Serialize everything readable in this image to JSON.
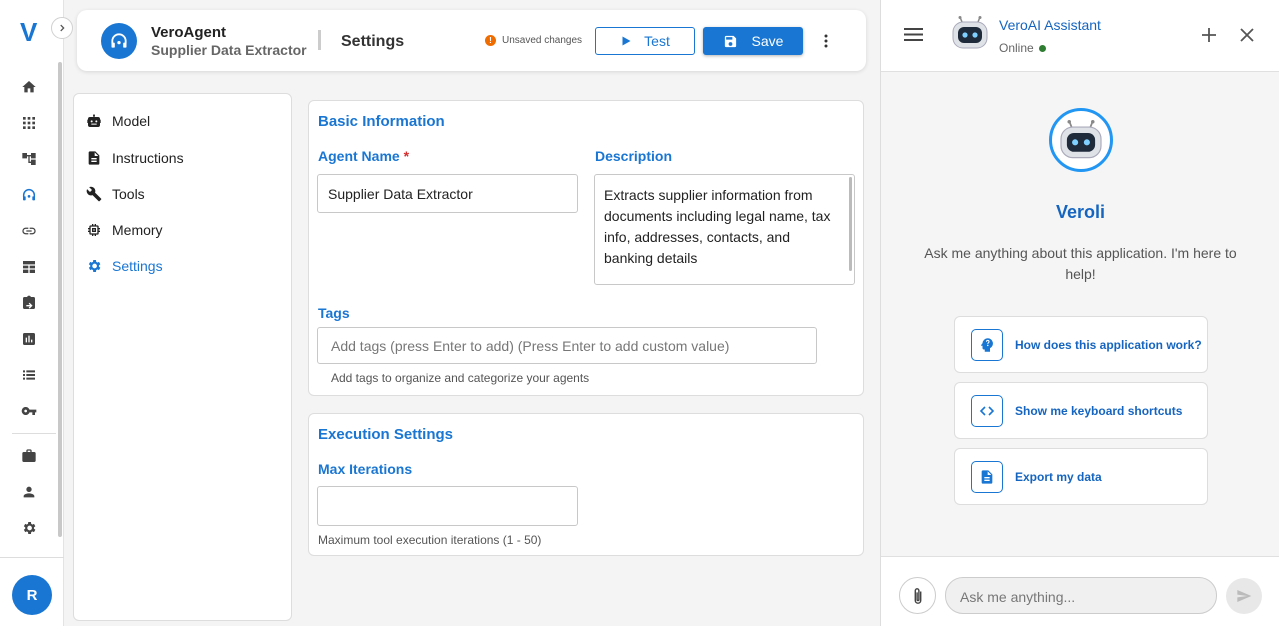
{
  "rail": {
    "logo": "V",
    "avatar_initial": "R",
    "items": [
      {
        "icon": "home-icon"
      },
      {
        "icon": "apps-grid-icon"
      },
      {
        "icon": "workflow-icon"
      },
      {
        "icon": "agent-icon"
      },
      {
        "icon": "link-icon"
      },
      {
        "icon": "table-icon"
      },
      {
        "icon": "clipboard-icon"
      },
      {
        "icon": "analytics-icon"
      },
      {
        "icon": "list-icon"
      },
      {
        "icon": "key-icon"
      },
      {
        "icon": "briefcase-icon"
      },
      {
        "icon": "person-icon"
      },
      {
        "icon": "gear-icon"
      }
    ]
  },
  "header": {
    "agent_name": "VeroAgent",
    "agent_subtitle": "Supplier Data Extractor",
    "page_title": "Settings",
    "unsaved_text": "Unsaved changes",
    "test_label": "Test",
    "save_label": "Save"
  },
  "menu": {
    "items": [
      {
        "label": "Model",
        "icon": "robot-icon"
      },
      {
        "label": "Instructions",
        "icon": "document-icon"
      },
      {
        "label": "Tools",
        "icon": "wrench-icon"
      },
      {
        "label": "Memory",
        "icon": "chip-icon"
      },
      {
        "label": "Settings",
        "icon": "gear-icon",
        "active": true
      }
    ]
  },
  "basic": {
    "title": "Basic Information",
    "name_label": "Agent Name",
    "required_mark": "*",
    "name_value": "Supplier Data Extractor",
    "desc_label": "Description",
    "desc_value": "Extracts supplier information from documents including legal name, tax info, addresses, contacts, and banking details",
    "tags_label": "Tags",
    "tags_placeholder": "Add tags (press Enter to add) (Press Enter to add custom value)",
    "tags_help": "Add tags to organize and categorize your agents"
  },
  "execution": {
    "title": "Execution Settings",
    "iter_label": "Max Iterations",
    "iter_value": "",
    "iter_help": "Maximum tool execution iterations (1 - 50)"
  },
  "assistant": {
    "title": "VeroAI Assistant",
    "status": "Online",
    "bot_name": "Veroli",
    "intro": "Ask me anything about this application. I'm here to help!",
    "suggestions": [
      {
        "label": "How does this application work?",
        "icon": "lightbulb-head-icon"
      },
      {
        "label": "Show me keyboard shortcuts",
        "icon": "code-icon"
      },
      {
        "label": "Export my data",
        "icon": "file-icon"
      }
    ],
    "input_placeholder": "Ask me anything..."
  },
  "colors": {
    "accent": "#1976d2",
    "warning": "#ef6c00",
    "online": "#2e7d32"
  }
}
